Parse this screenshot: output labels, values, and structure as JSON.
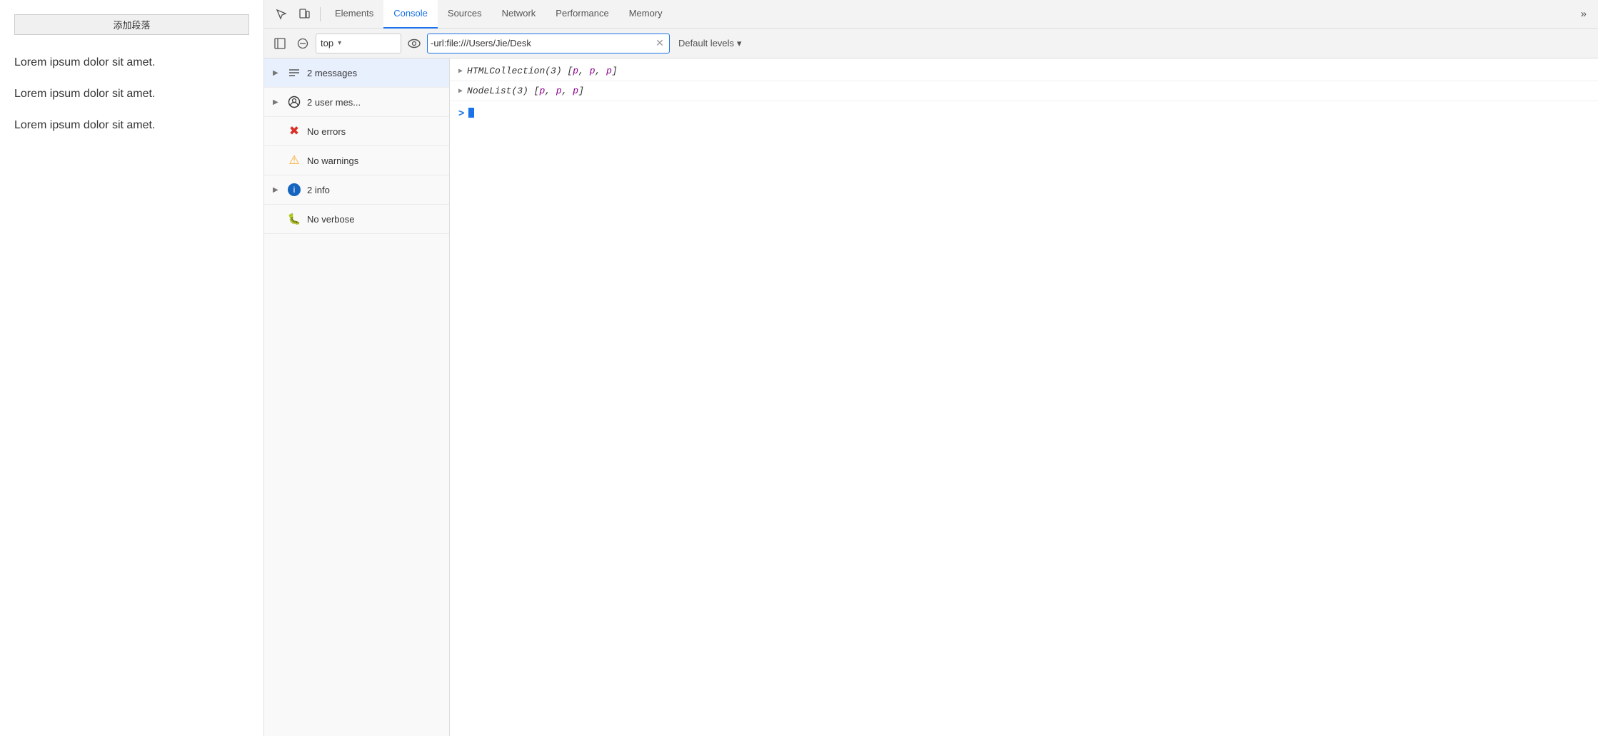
{
  "page": {
    "add_paragraph_btn": "添加段落",
    "paragraphs": [
      "Lorem ipsum dolor sit amet.",
      "Lorem ipsum dolor sit amet.",
      "Lorem ipsum dolor sit amet."
    ]
  },
  "devtools": {
    "tabs": [
      {
        "id": "elements",
        "label": "Elements",
        "active": false
      },
      {
        "id": "console",
        "label": "Console",
        "active": true
      },
      {
        "id": "sources",
        "label": "Sources",
        "active": false
      },
      {
        "id": "network",
        "label": "Network",
        "active": false
      },
      {
        "id": "performance",
        "label": "Performance",
        "active": false
      },
      {
        "id": "memory",
        "label": "Memory",
        "active": false
      }
    ],
    "more_tabs_label": "»",
    "toolbar": {
      "context_value": "top",
      "context_arrow": "▾",
      "filter_placeholder": "-url:file:///Users/Jie/Desk",
      "filter_value": "-url:file:///Users/Jie/Desk",
      "default_levels_label": "Default levels",
      "default_levels_arrow": "▾"
    },
    "sidebar": {
      "items": [
        {
          "id": "all-messages",
          "label": "2 messages",
          "has_arrow": true,
          "icon_type": "messages"
        },
        {
          "id": "user-messages",
          "label": "2 user mes...",
          "has_arrow": true,
          "icon_type": "user"
        },
        {
          "id": "errors",
          "label": "No errors",
          "has_arrow": false,
          "icon_type": "error"
        },
        {
          "id": "warnings",
          "label": "No warnings",
          "has_arrow": false,
          "icon_type": "warning"
        },
        {
          "id": "info",
          "label": "2 info",
          "has_arrow": true,
          "icon_type": "info"
        },
        {
          "id": "verbose",
          "label": "No verbose",
          "has_arrow": false,
          "icon_type": "verbose"
        }
      ]
    },
    "output": {
      "lines": [
        {
          "id": "line1",
          "arrow": "▶",
          "prefix": "HTMLCollection(3) [",
          "items": [
            "p",
            "p",
            "p"
          ],
          "suffix": "]"
        },
        {
          "id": "line2",
          "arrow": "▶",
          "prefix": "NodeList(3) [",
          "items": [
            "p",
            "p",
            "p"
          ],
          "suffix": "]"
        }
      ],
      "prompt_arrow": ">"
    }
  }
}
